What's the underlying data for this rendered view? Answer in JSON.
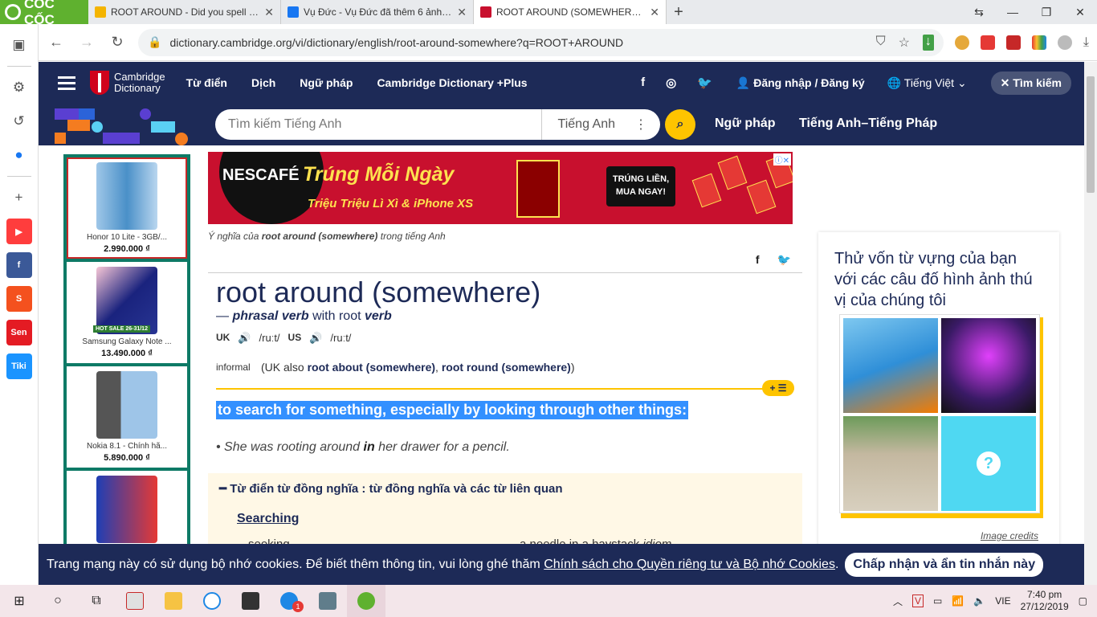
{
  "browser": {
    "brand": "CỐC CỐC",
    "tabs": [
      {
        "title": "ROOT AROUND - Did you spell it c",
        "active": false
      },
      {
        "title": "Vụ Đức - Vụ Đức đã thêm 6 ảnh m",
        "active": false
      },
      {
        "title": "ROOT AROUND (SOMEWHERE) | Đ",
        "active": true
      }
    ],
    "url": "dictionary.cambridge.org/vi/dictionary/english/root-around-somewhere?q=ROOT+AROUND"
  },
  "sidebar_apps": [
    "YouTube",
    "Facebook",
    "Shopee",
    "Sendo",
    "Tiki"
  ],
  "site": {
    "logo_line1": "Cambridge",
    "logo_line2": "Dictionary",
    "nav": [
      "Từ điển",
      "Dịch",
      "Ngữ pháp",
      "Cambridge Dictionary +Plus"
    ],
    "login": "Đăng nhập / Đăng ký",
    "language": "Tiếng Việt",
    "search_button": "Tìm kiếm",
    "search_placeholder": "Tìm kiếm Tiếng Anh",
    "search_dict": "Tiếng Anh",
    "band_links": [
      "Ngữ pháp",
      "Tiếng Anh–Tiếng Pháp"
    ]
  },
  "left_ads": [
    {
      "name": "Honor 10 Lite - 3GB/...",
      "price": "2.990.000 ₫"
    },
    {
      "name": "Samsung Galaxy Note ...",
      "price": "13.490.000 ₫",
      "tag": "HOT SALE 26-31/12"
    },
    {
      "name": "Nokia 8.1 - Chính hã...",
      "price": "5.890.000 ₫"
    },
    {
      "name": "",
      "price": ""
    }
  ],
  "banner": {
    "brand": "NESCAFÉ",
    "headline": "Trúng Mỗi Ngày",
    "subline": "Triệu Triệu Lì Xì & iPhone XS",
    "cta_line1": "TRÚNG LIỀN,",
    "cta_line2": "MUA NGAY!"
  },
  "entry": {
    "meaning_prefix": "Ý nghĩa của",
    "meaning_term": "root around (somewhere)",
    "meaning_suffix": "trong tiếng Anh",
    "headword": "root around (somewhere)",
    "pos_dash": "—",
    "pos": "phrasal verb",
    "pos_with": "with root",
    "pos_root": "verb",
    "uk_label": "UK",
    "uk_ipa": "/ruːt/",
    "us_label": "US",
    "us_ipa": "/ruːt/",
    "register": "informal",
    "also_open": "(UK also",
    "also1": "root about (somewhere)",
    "also_sep": ",",
    "also2": "root round (somewhere)",
    "also_close": ")",
    "definition": "to search for something, especially by looking through other things:",
    "example_pre": "She was rooting around",
    "example_bold": "in",
    "example_post": "her drawer for a pencil.",
    "thesaurus_title": "Từ điển từ đồng nghĩa : từ đồng nghĩa và các từ liên quan",
    "thesaurus_group": "Searching",
    "thesaurus_w1": "seeking",
    "thesaurus_w2": "a needle in a haystack",
    "thesaurus_w2_tag": "idiom"
  },
  "quiz": {
    "title": "Thử vốn từ vựng của bạn với các câu đố hình ảnh thú vị của chúng tôi",
    "credits": "Image credits"
  },
  "cookie": {
    "text": "Trang mạng này có sử dụng bộ nhớ cookies. Để biết thêm thông tin, vui lòng ghé thăm ",
    "link": "Chính sách cho Quyền riêng tư và Bộ nhớ Cookies",
    "end": ".",
    "accept": "Chấp nhận và ẩn tin nhắn này"
  },
  "taskbar": {
    "lang": "VIE",
    "time": "7:40 pm",
    "date": "27/12/2019",
    "badge": "1"
  }
}
